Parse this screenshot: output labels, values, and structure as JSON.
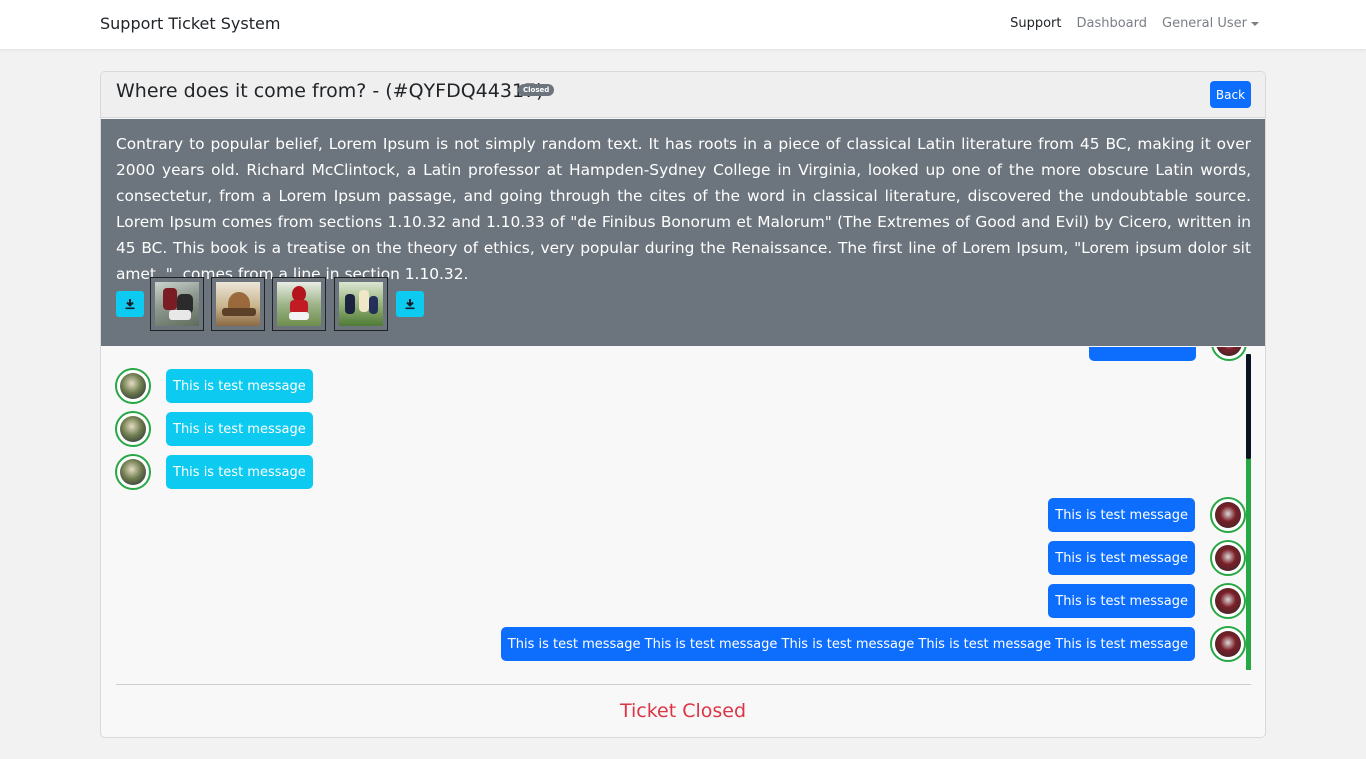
{
  "nav": {
    "brand": "Support Ticket System",
    "links": [
      "Support",
      "Dashboard",
      "General User"
    ]
  },
  "ticket": {
    "title": "Where does it come from? - (#QYFDQ44317)",
    "status_badge": "Closed",
    "back_label": "Back",
    "description": "Contrary to popular belief, Lorem Ipsum is not simply random text. It has roots in a piece of classical Latin literature from 45 BC, making it over 2000 years old. Richard McClintock, a Latin professor at Hampden-Sydney College in Virginia, looked up one of the more obscure Latin words, consectetur, from a Lorem Ipsum passage, and going through the cites of the word in classical literature, discovered the undoubtable source. Lorem Ipsum comes from sections 1.10.32 and 1.10.33 of \"de Finibus Bonorum et Malorum\" (The Extremes of Good and Evil) by Cicero, written in 45 BC. This book is a treatise on the theory of ethics, very popular during the Renaissance. The first line of Lorem Ipsum, \"Lorem ipsum dolor sit amet..\", comes from a line in section 1.10.32.",
    "attachments_icon": "download-icon"
  },
  "messages": [
    {
      "side": "in",
      "text": "This is test message"
    },
    {
      "side": "in",
      "text": "This is test message"
    },
    {
      "side": "in",
      "text": "This is test message"
    },
    {
      "side": "out",
      "text": "This is test message"
    },
    {
      "side": "out",
      "text": "This is test message"
    },
    {
      "side": "out",
      "text": "This is test message"
    },
    {
      "side": "out",
      "text": "This is test message This is test message This is test message This is test message This is test message"
    }
  ],
  "footer": {
    "closed_text": "Ticket Closed"
  },
  "colors": {
    "primary": "#0d6efd",
    "info": "#0dcaf0",
    "secondary": "#6c757d",
    "danger": "#dc3545",
    "success": "#28a745"
  }
}
